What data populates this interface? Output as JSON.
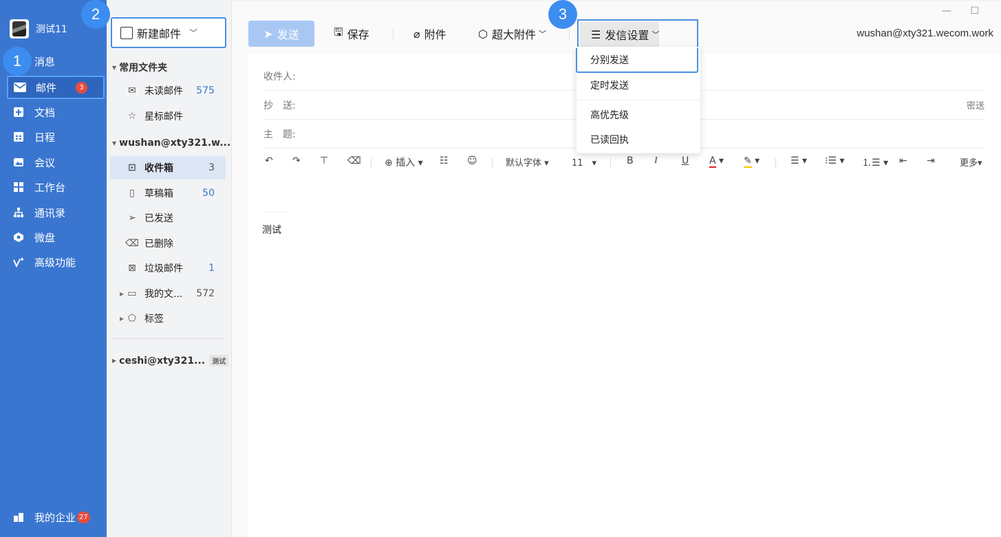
{
  "nav": {
    "username": "测试11",
    "items": [
      {
        "label": "消息",
        "icon": "chat-icon"
      },
      {
        "label": "邮件",
        "icon": "mail-icon",
        "badge": "3"
      },
      {
        "label": "文档",
        "icon": "doc-icon"
      },
      {
        "label": "日程",
        "icon": "calendar-icon"
      },
      {
        "label": "会议",
        "icon": "meeting-icon"
      },
      {
        "label": "工作台",
        "icon": "workbench-icon"
      },
      {
        "label": "通讯录",
        "icon": "contacts-icon"
      },
      {
        "label": "微盘",
        "icon": "drive-icon"
      },
      {
        "label": "高级功能",
        "icon": "advanced-icon"
      }
    ],
    "company": {
      "label": "我的企业",
      "badge": "27"
    }
  },
  "steps": [
    "1",
    "2",
    "3"
  ],
  "folders": {
    "compose_label": "新建邮件",
    "common_header": "常用文件夹",
    "common": [
      {
        "label": "未读邮件",
        "count": "575"
      },
      {
        "label": "星标邮件",
        "count": ""
      }
    ],
    "account_header": "wushan@xty321.w...",
    "account": [
      {
        "label": "收件箱",
        "count": "3"
      },
      {
        "label": "草稿箱",
        "count": "50"
      },
      {
        "label": "已发送",
        "count": ""
      },
      {
        "label": "已删除",
        "count": ""
      },
      {
        "label": "垃圾邮件",
        "count": "1"
      },
      {
        "label": "我的文...",
        "count": "572"
      },
      {
        "label": "标签",
        "count": ""
      }
    ],
    "second_account": "ceshi@xty321...",
    "second_account_tag": "测试"
  },
  "toolbar": {
    "send": "发送",
    "save": "保存",
    "attach": "附件",
    "big_attach": "超大附件",
    "send_settings": "发信设置",
    "account": "wushan@xty321.wecom.work"
  },
  "compose": {
    "to_label": "收件人:",
    "cc_label": "抄　送:",
    "bcc_label": "密送",
    "subject_label": "主　题:",
    "body": "测试"
  },
  "format": {
    "insert": "插入",
    "font": "默认字体",
    "size": "11",
    "more": "更多"
  },
  "menu": {
    "items": [
      "分别发送",
      "定时发送",
      "高优先级",
      "已读回执"
    ]
  },
  "colors": {
    "nav_bg": "#3a76d0",
    "accent": "#4a90e2",
    "badge": "#e84c3d"
  }
}
